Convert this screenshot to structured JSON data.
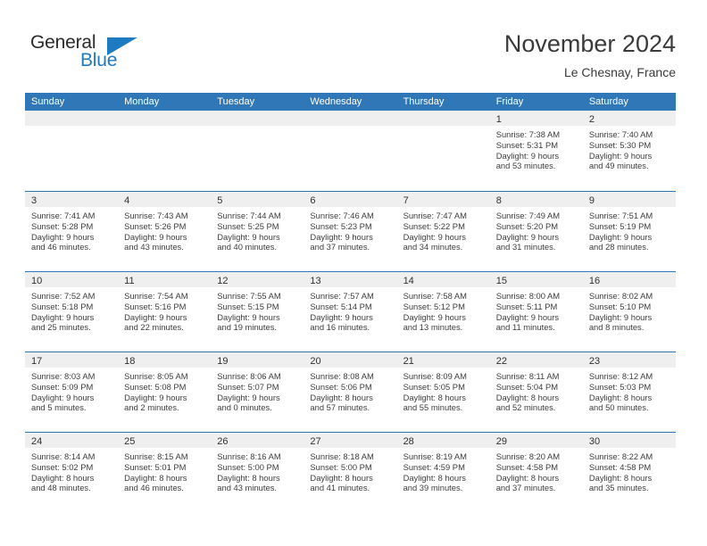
{
  "brand": {
    "name_part1": "General",
    "name_part2": "Blue",
    "accent_color": "#1f7bc1"
  },
  "header": {
    "title": "November 2024",
    "location": "Le Chesnay, France",
    "header_bg_color": "#3077b8",
    "daynum_band_color": "#efefef"
  },
  "weekdays": [
    {
      "label": "Sunday"
    },
    {
      "label": "Monday"
    },
    {
      "label": "Tuesday"
    },
    {
      "label": "Wednesday"
    },
    {
      "label": "Thursday"
    },
    {
      "label": "Friday"
    },
    {
      "label": "Saturday"
    }
  ],
  "weeks": [
    [
      {
        "day": "",
        "empty": true,
        "lines": []
      },
      {
        "day": "",
        "empty": true,
        "lines": []
      },
      {
        "day": "",
        "empty": true,
        "lines": []
      },
      {
        "day": "",
        "empty": true,
        "lines": []
      },
      {
        "day": "",
        "empty": true,
        "lines": []
      },
      {
        "day": "1",
        "empty": false,
        "lines": [
          "Sunrise: 7:38 AM",
          "Sunset: 5:31 PM",
          "Daylight: 9 hours",
          "and 53 minutes."
        ]
      },
      {
        "day": "2",
        "empty": false,
        "lines": [
          "Sunrise: 7:40 AM",
          "Sunset: 5:30 PM",
          "Daylight: 9 hours",
          "and 49 minutes."
        ]
      }
    ],
    [
      {
        "day": "3",
        "empty": false,
        "lines": [
          "Sunrise: 7:41 AM",
          "Sunset: 5:28 PM",
          "Daylight: 9 hours",
          "and 46 minutes."
        ]
      },
      {
        "day": "4",
        "empty": false,
        "lines": [
          "Sunrise: 7:43 AM",
          "Sunset: 5:26 PM",
          "Daylight: 9 hours",
          "and 43 minutes."
        ]
      },
      {
        "day": "5",
        "empty": false,
        "lines": [
          "Sunrise: 7:44 AM",
          "Sunset: 5:25 PM",
          "Daylight: 9 hours",
          "and 40 minutes."
        ]
      },
      {
        "day": "6",
        "empty": false,
        "lines": [
          "Sunrise: 7:46 AM",
          "Sunset: 5:23 PM",
          "Daylight: 9 hours",
          "and 37 minutes."
        ]
      },
      {
        "day": "7",
        "empty": false,
        "lines": [
          "Sunrise: 7:47 AM",
          "Sunset: 5:22 PM",
          "Daylight: 9 hours",
          "and 34 minutes."
        ]
      },
      {
        "day": "8",
        "empty": false,
        "lines": [
          "Sunrise: 7:49 AM",
          "Sunset: 5:20 PM",
          "Daylight: 9 hours",
          "and 31 minutes."
        ]
      },
      {
        "day": "9",
        "empty": false,
        "lines": [
          "Sunrise: 7:51 AM",
          "Sunset: 5:19 PM",
          "Daylight: 9 hours",
          "and 28 minutes."
        ]
      }
    ],
    [
      {
        "day": "10",
        "empty": false,
        "lines": [
          "Sunrise: 7:52 AM",
          "Sunset: 5:18 PM",
          "Daylight: 9 hours",
          "and 25 minutes."
        ]
      },
      {
        "day": "11",
        "empty": false,
        "lines": [
          "Sunrise: 7:54 AM",
          "Sunset: 5:16 PM",
          "Daylight: 9 hours",
          "and 22 minutes."
        ]
      },
      {
        "day": "12",
        "empty": false,
        "lines": [
          "Sunrise: 7:55 AM",
          "Sunset: 5:15 PM",
          "Daylight: 9 hours",
          "and 19 minutes."
        ]
      },
      {
        "day": "13",
        "empty": false,
        "lines": [
          "Sunrise: 7:57 AM",
          "Sunset: 5:14 PM",
          "Daylight: 9 hours",
          "and 16 minutes."
        ]
      },
      {
        "day": "14",
        "empty": false,
        "lines": [
          "Sunrise: 7:58 AM",
          "Sunset: 5:12 PM",
          "Daylight: 9 hours",
          "and 13 minutes."
        ]
      },
      {
        "day": "15",
        "empty": false,
        "lines": [
          "Sunrise: 8:00 AM",
          "Sunset: 5:11 PM",
          "Daylight: 9 hours",
          "and 11 minutes."
        ]
      },
      {
        "day": "16",
        "empty": false,
        "lines": [
          "Sunrise: 8:02 AM",
          "Sunset: 5:10 PM",
          "Daylight: 9 hours",
          "and 8 minutes."
        ]
      }
    ],
    [
      {
        "day": "17",
        "empty": false,
        "lines": [
          "Sunrise: 8:03 AM",
          "Sunset: 5:09 PM",
          "Daylight: 9 hours",
          "and 5 minutes."
        ]
      },
      {
        "day": "18",
        "empty": false,
        "lines": [
          "Sunrise: 8:05 AM",
          "Sunset: 5:08 PM",
          "Daylight: 9 hours",
          "and 2 minutes."
        ]
      },
      {
        "day": "19",
        "empty": false,
        "lines": [
          "Sunrise: 8:06 AM",
          "Sunset: 5:07 PM",
          "Daylight: 9 hours",
          "and 0 minutes."
        ]
      },
      {
        "day": "20",
        "empty": false,
        "lines": [
          "Sunrise: 8:08 AM",
          "Sunset: 5:06 PM",
          "Daylight: 8 hours",
          "and 57 minutes."
        ]
      },
      {
        "day": "21",
        "empty": false,
        "lines": [
          "Sunrise: 8:09 AM",
          "Sunset: 5:05 PM",
          "Daylight: 8 hours",
          "and 55 minutes."
        ]
      },
      {
        "day": "22",
        "empty": false,
        "lines": [
          "Sunrise: 8:11 AM",
          "Sunset: 5:04 PM",
          "Daylight: 8 hours",
          "and 52 minutes."
        ]
      },
      {
        "day": "23",
        "empty": false,
        "lines": [
          "Sunrise: 8:12 AM",
          "Sunset: 5:03 PM",
          "Daylight: 8 hours",
          "and 50 minutes."
        ]
      }
    ],
    [
      {
        "day": "24",
        "empty": false,
        "lines": [
          "Sunrise: 8:14 AM",
          "Sunset: 5:02 PM",
          "Daylight: 8 hours",
          "and 48 minutes."
        ]
      },
      {
        "day": "25",
        "empty": false,
        "lines": [
          "Sunrise: 8:15 AM",
          "Sunset: 5:01 PM",
          "Daylight: 8 hours",
          "and 46 minutes."
        ]
      },
      {
        "day": "26",
        "empty": false,
        "lines": [
          "Sunrise: 8:16 AM",
          "Sunset: 5:00 PM",
          "Daylight: 8 hours",
          "and 43 minutes."
        ]
      },
      {
        "day": "27",
        "empty": false,
        "lines": [
          "Sunrise: 8:18 AM",
          "Sunset: 5:00 PM",
          "Daylight: 8 hours",
          "and 41 minutes."
        ]
      },
      {
        "day": "28",
        "empty": false,
        "lines": [
          "Sunrise: 8:19 AM",
          "Sunset: 4:59 PM",
          "Daylight: 8 hours",
          "and 39 minutes."
        ]
      },
      {
        "day": "29",
        "empty": false,
        "lines": [
          "Sunrise: 8:20 AM",
          "Sunset: 4:58 PM",
          "Daylight: 8 hours",
          "and 37 minutes."
        ]
      },
      {
        "day": "30",
        "empty": false,
        "lines": [
          "Sunrise: 8:22 AM",
          "Sunset: 4:58 PM",
          "Daylight: 8 hours",
          "and 35 minutes."
        ]
      }
    ]
  ]
}
